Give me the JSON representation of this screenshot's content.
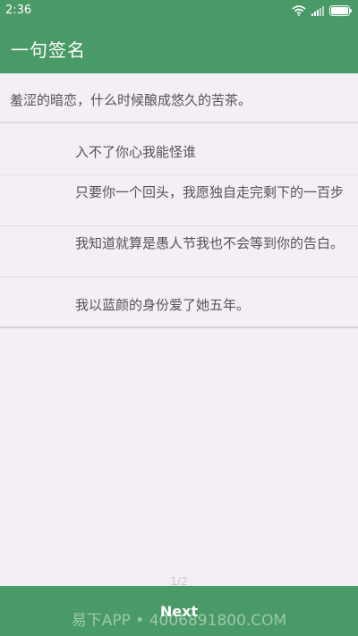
{
  "status_bar": {
    "time": "2:36",
    "icons": [
      "wifi-icon",
      "signal-icon",
      "battery-icon"
    ]
  },
  "app_bar": {
    "title": "一句签名"
  },
  "featured": {
    "text": "羞涩的暗恋，什么时候酿成悠久的苦茶。"
  },
  "list": [
    {
      "text": "入不了你心我能怪谁"
    },
    {
      "text": "只要你一个回头，我愿独自走完剩下的一百步"
    },
    {
      "text": "我知道就算是愚人节我也不会等到你的告白。"
    },
    {
      "text": "我以蓝颜的身份爱了她五年。"
    }
  ],
  "pager": {
    "indicator": "1/2",
    "next_label": "Next"
  },
  "watermark": {
    "text": "易下APP • 4006891800.COM"
  },
  "colors": {
    "primary": "#4a9a67",
    "background": "#f4eef6"
  }
}
